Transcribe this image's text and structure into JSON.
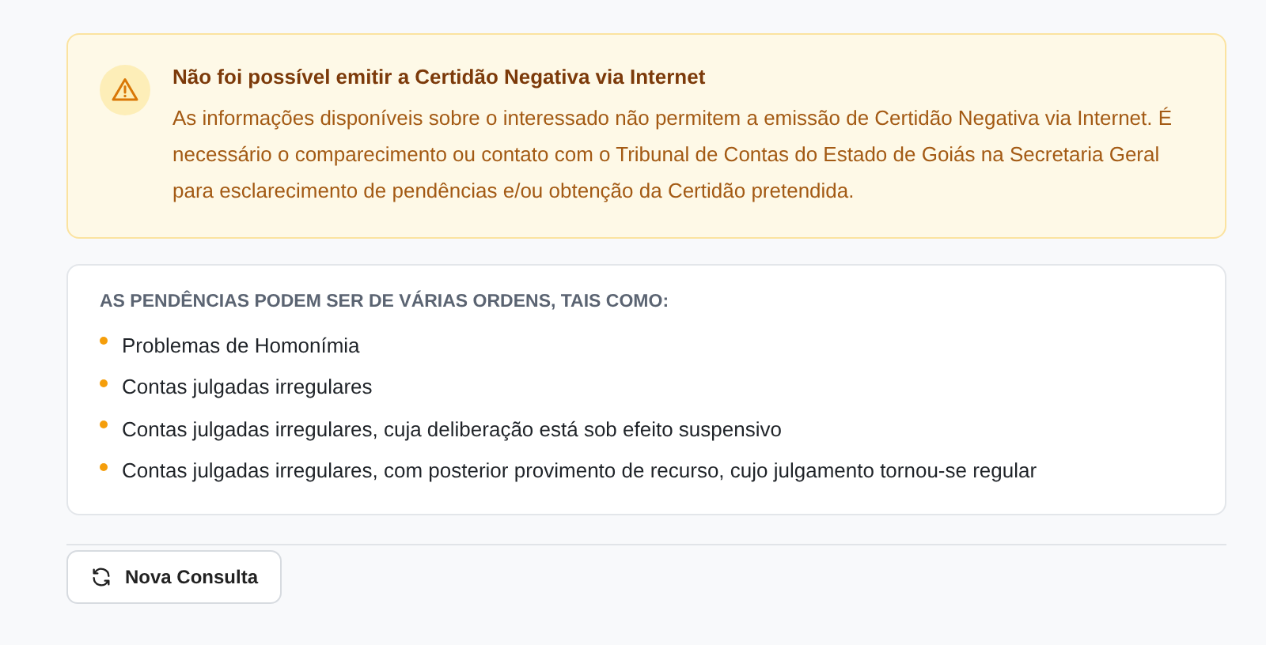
{
  "alert": {
    "title": "Não foi possível emitir a Certidão Negativa via Internet",
    "message": "As informações disponíveis sobre o interessado não permitem a emissão de Certidão Negativa via Internet. É necessário o comparecimento ou contato com o Tribunal de Contas do Estado de Goiás na Secretaria Geral para esclarecimento de pendências e/ou obtenção da Certidão pretendida."
  },
  "pending": {
    "heading": "AS PENDÊNCIAS PODEM SER DE VÁRIAS ORDENS, TAIS COMO:",
    "items": [
      "Problemas de Homonímia",
      "Contas julgadas irregulares",
      "Contas julgadas irregulares, cuja deliberação está sob efeito suspensivo",
      "Contas julgadas irregulares, com posterior provimento de recurso, cujo julgamento tornou-se regular"
    ]
  },
  "button": {
    "label": "Nova Consulta"
  }
}
